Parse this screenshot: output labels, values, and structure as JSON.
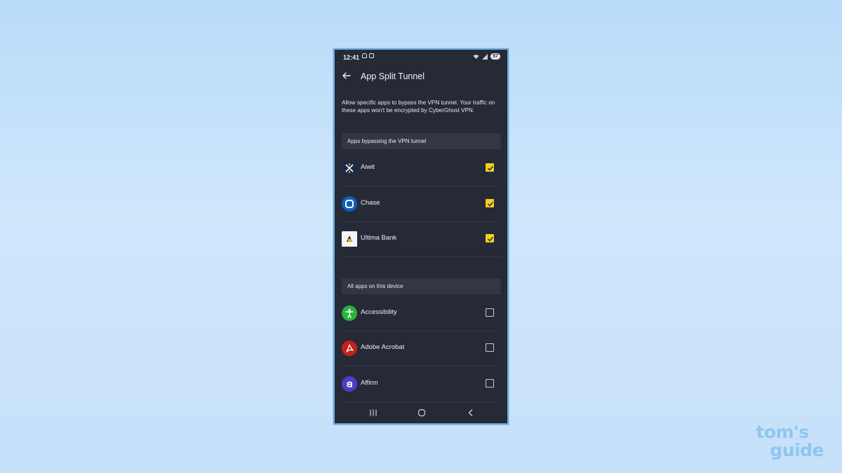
{
  "status_bar": {
    "time": "12:41",
    "battery": "57"
  },
  "app_bar": {
    "title": "App Split Tunnel"
  },
  "description": "Allow specific apps to bypass the VPN tunnel. Your traffic on these apps won't be encrypted by CyberGhost VPN.",
  "sections": {
    "bypassing": {
      "header": "Apps bypassing the VPN tunnel",
      "apps": [
        {
          "name": "Aiwit",
          "checked": true
        },
        {
          "name": "Chase",
          "checked": true
        },
        {
          "name": "Ultima Bank",
          "checked": true
        }
      ]
    },
    "all_apps": {
      "header": "All apps on this device",
      "apps": [
        {
          "name": "Accessibility",
          "checked": false
        },
        {
          "name": "Adobe Acrobat",
          "checked": false
        },
        {
          "name": "Affirm",
          "checked": false
        }
      ]
    }
  },
  "colors": {
    "checkbox_accent": "#f2cf1d",
    "background": "#262a37",
    "chase_blue": "#1060b8",
    "accessibility_green": "#29b43b",
    "acrobat_red": "#c4201c",
    "affirm_purple": "#4a3fc4"
  },
  "icons": {
    "back": "back-arrow-icon",
    "nav_recents": "recents-icon",
    "nav_home": "home-icon",
    "nav_back": "nav-back-icon"
  },
  "watermark": {
    "line1": "tom's",
    "line2": "guide"
  }
}
